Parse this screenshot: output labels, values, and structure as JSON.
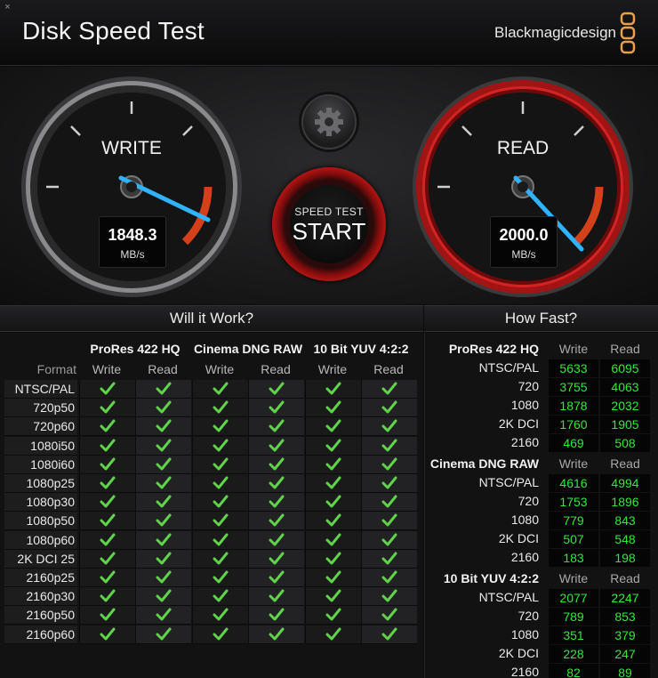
{
  "window": {
    "title": "Disk Speed Test",
    "brand": "Blackmagicdesign",
    "close_glyph": "×"
  },
  "colors": {
    "accent_blue": "#2fb2ff",
    "read_red": "#c51a1a",
    "check_green": "#5fd34a",
    "value_green": "#33e63a"
  },
  "write_gauge": {
    "label": "WRITE",
    "value": "1848.3",
    "unit": "MB/s"
  },
  "read_gauge": {
    "label": "READ",
    "value": "2000.0",
    "unit": "MB/s"
  },
  "controls": {
    "settings_icon": "gear-icon",
    "start_top": "SPEED TEST",
    "start_main": "START"
  },
  "will_it_work": {
    "title": "Will it Work?",
    "format_header": "Format",
    "groups": [
      {
        "name": "ProRes 422 HQ",
        "write": "Write",
        "read": "Read"
      },
      {
        "name": "Cinema DNG RAW",
        "write": "Write",
        "read": "Read"
      },
      {
        "name": "10 Bit YUV 4:2:2",
        "write": "Write",
        "read": "Read"
      }
    ],
    "formats": [
      "NTSC/PAL",
      "720p50",
      "720p60",
      "1080i50",
      "1080i60",
      "1080p25",
      "1080p30",
      "1080p50",
      "1080p60",
      "2K DCI 25",
      "2160p25",
      "2160p30",
      "2160p50",
      "2160p60"
    ],
    "result_icon": "check-icon"
  },
  "how_fast": {
    "title": "How Fast?",
    "sections": [
      {
        "name": "ProRes 422 HQ",
        "write": "Write",
        "read": "Read",
        "rows": [
          {
            "label": "NTSC/PAL",
            "write": "5633",
            "read": "6095"
          },
          {
            "label": "720",
            "write": "3755",
            "read": "4063"
          },
          {
            "label": "1080",
            "write": "1878",
            "read": "2032"
          },
          {
            "label": "2K DCI",
            "write": "1760",
            "read": "1905"
          },
          {
            "label": "2160",
            "write": "469",
            "read": "508"
          }
        ]
      },
      {
        "name": "Cinema DNG RAW",
        "write": "Write",
        "read": "Read",
        "rows": [
          {
            "label": "NTSC/PAL",
            "write": "4616",
            "read": "4994"
          },
          {
            "label": "720",
            "write": "1753",
            "read": "1896"
          },
          {
            "label": "1080",
            "write": "779",
            "read": "843"
          },
          {
            "label": "2K DCI",
            "write": "507",
            "read": "548"
          },
          {
            "label": "2160",
            "write": "183",
            "read": "198"
          }
        ]
      },
      {
        "name": "10 Bit YUV 4:2:2",
        "write": "Write",
        "read": "Read",
        "rows": [
          {
            "label": "NTSC/PAL",
            "write": "2077",
            "read": "2247"
          },
          {
            "label": "720",
            "write": "789",
            "read": "853"
          },
          {
            "label": "1080",
            "write": "351",
            "read": "379"
          },
          {
            "label": "2K DCI",
            "write": "228",
            "read": "247"
          },
          {
            "label": "2160",
            "write": "82",
            "read": "89"
          }
        ]
      }
    ]
  }
}
